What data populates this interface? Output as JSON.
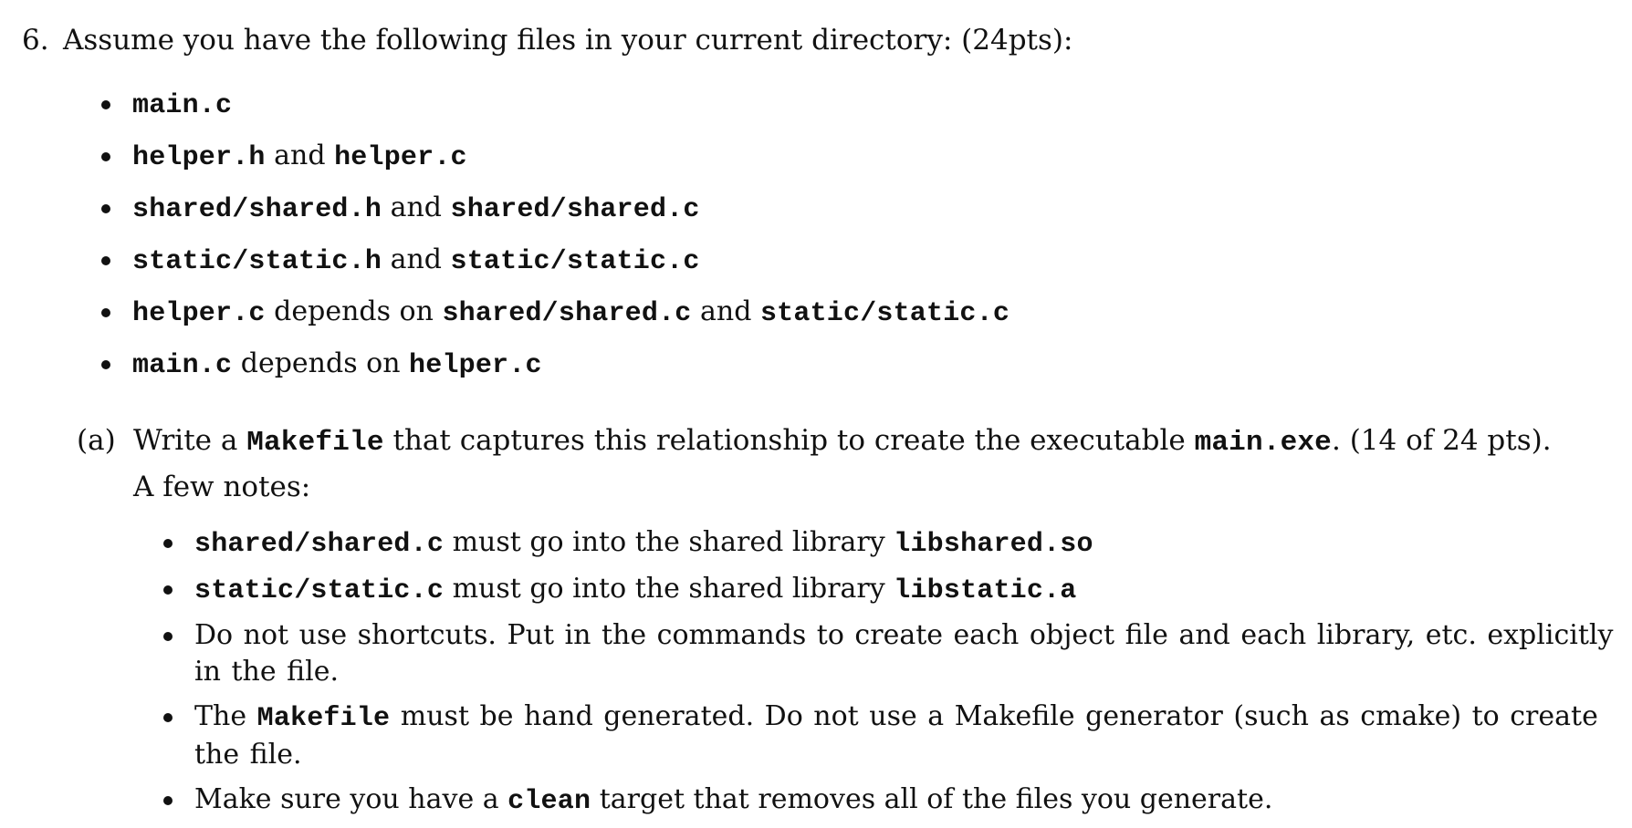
{
  "question": {
    "number": "6.",
    "text": "Assume you have the following files in your current directory: (24pts):"
  },
  "files": [
    {
      "parts": [
        {
          "mono": true,
          "text": "main.c"
        }
      ]
    },
    {
      "parts": [
        {
          "mono": true,
          "text": "helper.h"
        },
        {
          "mono": false,
          "text": " and "
        },
        {
          "mono": true,
          "text": "helper.c"
        }
      ]
    },
    {
      "parts": [
        {
          "mono": true,
          "text": "shared/shared.h"
        },
        {
          "mono": false,
          "text": " and "
        },
        {
          "mono": true,
          "text": "shared/shared.c"
        }
      ]
    },
    {
      "parts": [
        {
          "mono": true,
          "text": "static/static.h"
        },
        {
          "mono": false,
          "text": " and "
        },
        {
          "mono": true,
          "text": "static/static.c"
        }
      ]
    },
    {
      "parts": [
        {
          "mono": true,
          "text": "helper.c"
        },
        {
          "mono": false,
          "text": " depends on "
        },
        {
          "mono": true,
          "text": "shared/shared.c"
        },
        {
          "mono": false,
          "text": " and "
        },
        {
          "mono": true,
          "text": "static/static.c"
        }
      ]
    },
    {
      "parts": [
        {
          "mono": true,
          "text": "main.c"
        },
        {
          "mono": false,
          "text": " depends on "
        },
        {
          "mono": true,
          "text": "helper.c"
        }
      ]
    }
  ],
  "part_a": {
    "label": "(a)",
    "parts": [
      {
        "mono": false,
        "text": "Write a "
      },
      {
        "mono": true,
        "text": "Makefile"
      },
      {
        "mono": false,
        "text": " that captures this relationship to create the executable "
      },
      {
        "mono": true,
        "text": "main.exe"
      },
      {
        "mono": false,
        "text": ". (14 of 24 pts)."
      }
    ]
  },
  "notes_heading": "A few notes:",
  "notes": [
    {
      "parts": [
        {
          "mono": true,
          "text": "shared/shared.c"
        },
        {
          "mono": false,
          "text": " must go into the shared library "
        },
        {
          "mono": true,
          "text": "libshared.so"
        }
      ]
    },
    {
      "parts": [
        {
          "mono": true,
          "text": "static/static.c"
        },
        {
          "mono": false,
          "text": " must go into the shared library "
        },
        {
          "mono": true,
          "text": "libstatic.a"
        }
      ]
    },
    {
      "parts": [
        {
          "mono": false,
          "text": "Do not use shortcuts. Put in the commands to create each object file and each library, etc. explicitly in the file."
        }
      ]
    },
    {
      "parts": [
        {
          "mono": false,
          "text": "The "
        },
        {
          "mono": true,
          "text": "Makefile"
        },
        {
          "mono": false,
          "text": " must be hand generated. Do not use a Makefile generator (such as cmake) to create the file."
        }
      ]
    },
    {
      "parts": [
        {
          "mono": false,
          "text": "Make sure you have a "
        },
        {
          "mono": true,
          "text": "clean"
        },
        {
          "mono": false,
          "text": " target that removes all of the files you generate."
        }
      ]
    }
  ]
}
